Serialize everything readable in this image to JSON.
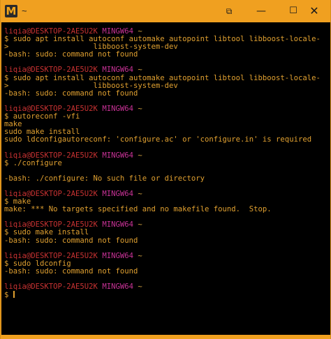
{
  "window": {
    "title": "~",
    "app_icon_letter": "M",
    "controls": {
      "options": "⧉",
      "minimize": "—",
      "maximize": "☐",
      "close": "✕"
    }
  },
  "prompt": {
    "user_host": "liqia@DESKTOP-2AE5U2K",
    "env": "MINGW64",
    "path": "~"
  },
  "lines": [
    {
      "type": "prompt"
    },
    {
      "type": "text",
      "text": "$ sudo apt install autoconf automake autopoint libtool libboost-locale-dev \\"
    },
    {
      "type": "text",
      "text": ">                   libboost-system-dev"
    },
    {
      "type": "text",
      "text": "-bash: sudo: command not found"
    },
    {
      "type": "blank"
    },
    {
      "type": "prompt"
    },
    {
      "type": "text",
      "text": "$ sudo apt install autoconf automake autopoint libtool libboost-locale-dev \\"
    },
    {
      "type": "text",
      "text": ">                   libboost-system-dev"
    },
    {
      "type": "text",
      "text": "-bash: sudo: command not found"
    },
    {
      "type": "blank"
    },
    {
      "type": "prompt"
    },
    {
      "type": "text",
      "text": "$ autoreconf -vfi"
    },
    {
      "type": "text",
      "text": "make"
    },
    {
      "type": "text",
      "text": "sudo make install"
    },
    {
      "type": "text",
      "text": "sudo ldconfigautoreconf: 'configure.ac' or 'configure.in' is required"
    },
    {
      "type": "blank"
    },
    {
      "type": "prompt"
    },
    {
      "type": "text",
      "text": "$ ./configure"
    },
    {
      "type": "blank"
    },
    {
      "type": "text",
      "text": "-bash: ./configure: No such file or directory"
    },
    {
      "type": "blank"
    },
    {
      "type": "prompt"
    },
    {
      "type": "text",
      "text": "$ make"
    },
    {
      "type": "text",
      "text": "make: *** No targets specified and no makefile found.  Stop."
    },
    {
      "type": "blank"
    },
    {
      "type": "prompt"
    },
    {
      "type": "text",
      "text": "$ sudo make install"
    },
    {
      "type": "text",
      "text": "-bash: sudo: command not found"
    },
    {
      "type": "blank"
    },
    {
      "type": "prompt"
    },
    {
      "type": "text",
      "text": "$ sudo ldconfig"
    },
    {
      "type": "text",
      "text": "-bash: sudo: command not found"
    },
    {
      "type": "blank"
    },
    {
      "type": "prompt"
    },
    {
      "type": "input",
      "text": "$ "
    }
  ]
}
